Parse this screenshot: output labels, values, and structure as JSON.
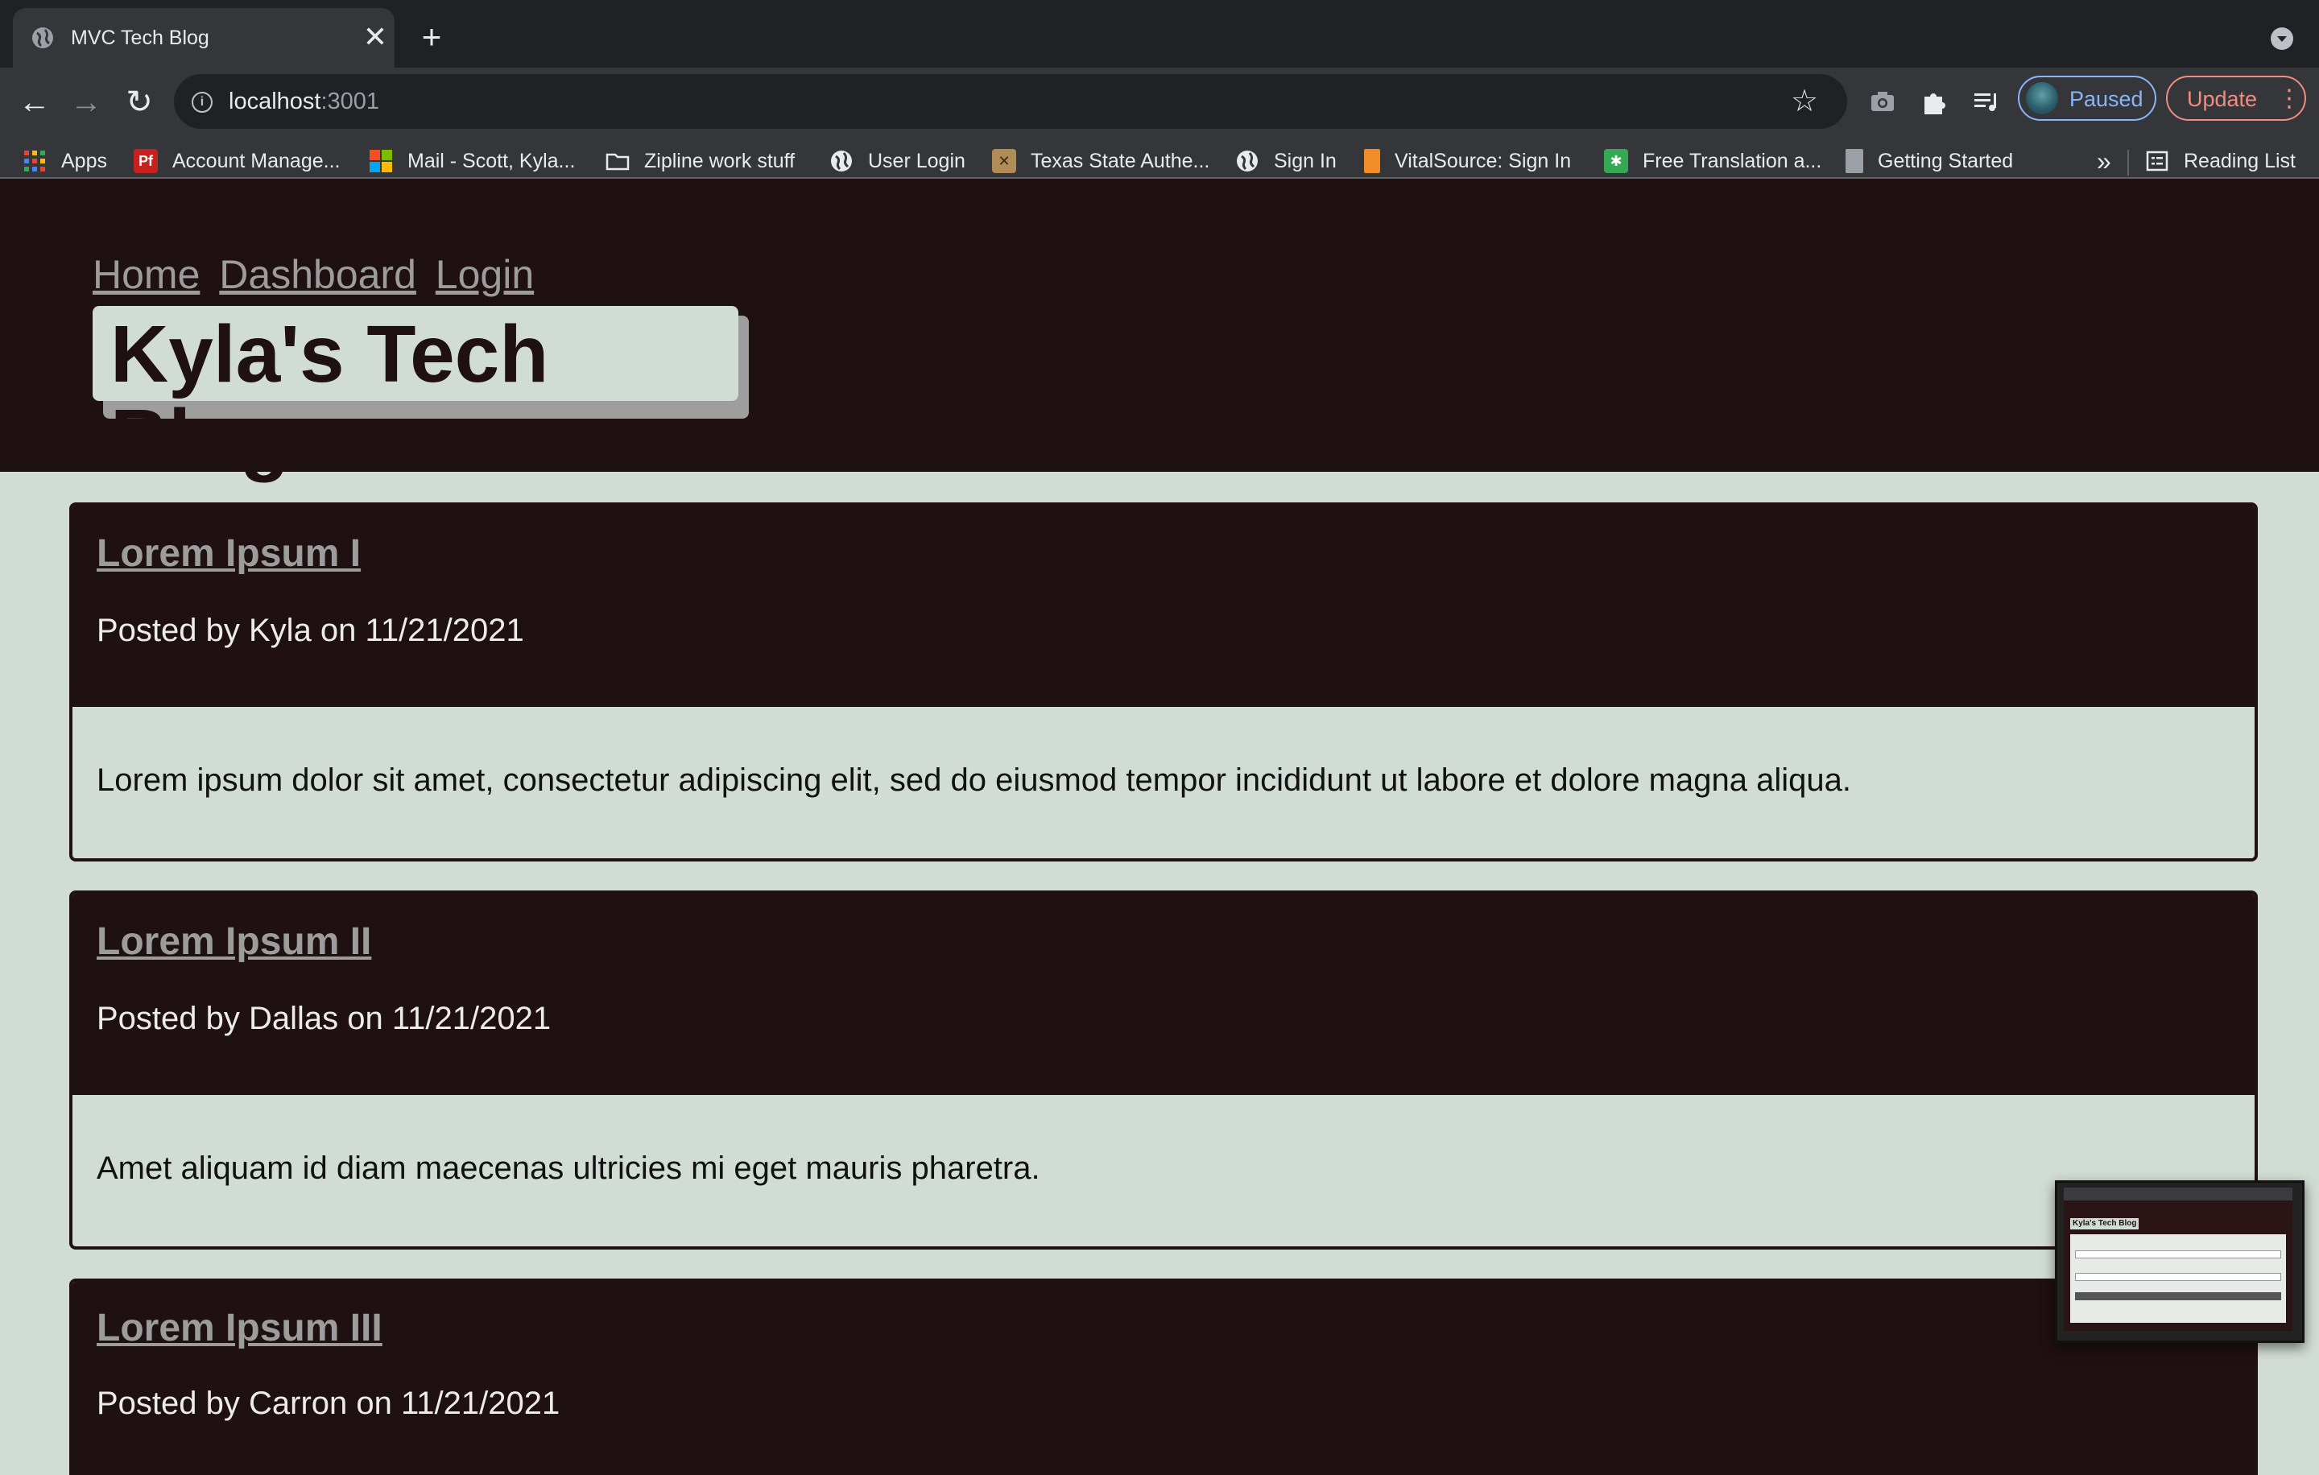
{
  "browser": {
    "tab": {
      "title": "MVC Tech Blog",
      "close": "✕"
    },
    "new_tab": "+",
    "url": {
      "host": "localhost",
      "port": ":3001"
    },
    "profile": {
      "label": "Paused"
    },
    "update": {
      "label": "Update",
      "menu": "⋮"
    },
    "bookmarks": [
      {
        "label": "Apps",
        "icon": "apps-grid-icon",
        "color": "#ea4335"
      },
      {
        "label": "Account Manage...",
        "icon": "pf-icon",
        "color": "#c5221f"
      },
      {
        "label": "Mail - Scott, Kyla...",
        "icon": "microsoft-icon",
        "color": "#00a4ef"
      },
      {
        "label": "Zipline work stuff",
        "icon": "folder-icon",
        "color": "#e8eaed"
      },
      {
        "label": "User Login",
        "icon": "globe-icon",
        "color": "#e8eaed"
      },
      {
        "label": "Texas State Authe...",
        "icon": "texas-state-icon",
        "color": "#b08d57"
      },
      {
        "label": "Sign In",
        "icon": "globe-icon",
        "color": "#e8eaed"
      },
      {
        "label": "VitalSource: Sign In",
        "icon": "vitalsource-icon",
        "color": "#f28c28"
      },
      {
        "label": "Free Translation a...",
        "icon": "translation-icon",
        "color": "#34a853"
      },
      {
        "label": "Getting Started",
        "icon": "page-icon",
        "color": "#9aa0a6"
      }
    ],
    "bookmarks_overflow": "»",
    "reading_list": "Reading List"
  },
  "site": {
    "nav": [
      "Home",
      "Dashboard",
      "Login"
    ],
    "title": "Kyla's Tech Blog"
  },
  "posts": [
    {
      "title": "Lorem Ipsum I",
      "meta": "Posted by Kyla on 11/21/2021",
      "body": "Lorem ipsum dolor sit amet, consectetur adipiscing elit, sed do eiusmod tempor incididunt ut labore et dolore magna aliqua."
    },
    {
      "title": "Lorem Ipsum II",
      "meta": "Posted by Dallas on 11/21/2021",
      "body": "Amet aliquam id diam maecenas ultricies mi eget mauris pharetra."
    },
    {
      "title": "Lorem Ipsum III",
      "meta": "Posted by Carron on 11/21/2021",
      "body": ""
    }
  ],
  "pip": {
    "brand": "Kyla's Tech Blog"
  },
  "colors": {
    "header_bg": "#1f1011",
    "page_bg": "#d1dcd4",
    "link": "#9c9c9c"
  }
}
